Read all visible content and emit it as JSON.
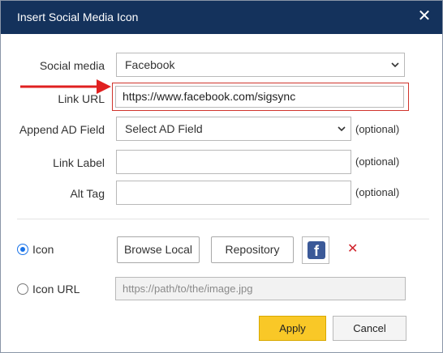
{
  "dialog": {
    "title": "Insert Social Media Icon",
    "close_icon": "close-icon",
    "title_bar_color": "#14325c"
  },
  "form": {
    "social_media": {
      "label": "Social media",
      "value": "Facebook"
    },
    "link_url": {
      "label": "Link URL",
      "value": "https://www.facebook.com/sigsync"
    },
    "append_ad_field": {
      "label": "Append AD Field",
      "value": "Select AD Field",
      "optional": "(optional)"
    },
    "link_label": {
      "label": "Link Label",
      "value": "",
      "optional": "(optional)"
    },
    "alt_tag": {
      "label": "Alt Tag",
      "value": "",
      "optional": "(optional)"
    }
  },
  "icon_source": {
    "icon_option": {
      "label": "Icon",
      "selected": true
    },
    "browse_local_label": "Browse Local",
    "repository_label": "Repository",
    "preview_icon": "facebook-icon",
    "preview_glyph": "f",
    "remove_icon": "remove-icon",
    "icon_url_option": {
      "label": "Icon URL",
      "selected": false,
      "placeholder": "https://path/to/the/image.jpg"
    }
  },
  "buttons": {
    "apply": "Apply",
    "cancel": "Cancel"
  },
  "annotation": {
    "arrow_color": "#e02020",
    "highlight_color": "#d0342c"
  }
}
